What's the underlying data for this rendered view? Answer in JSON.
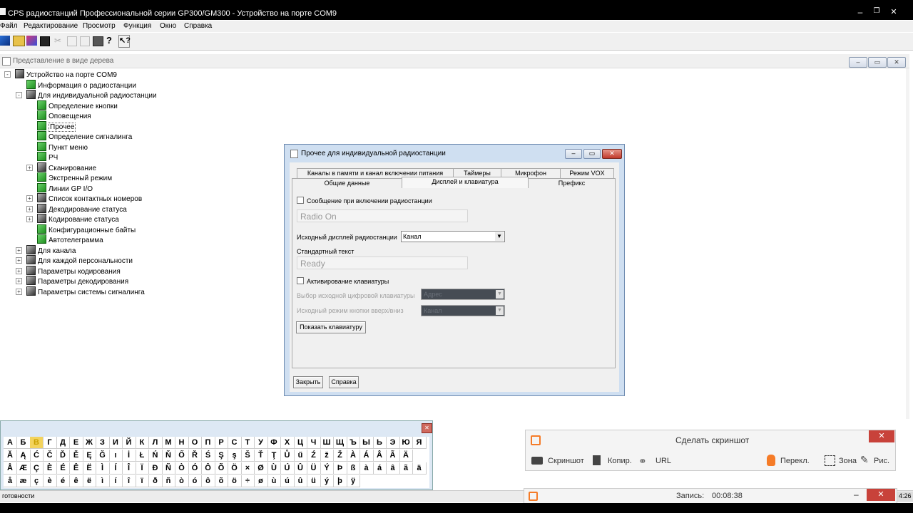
{
  "app": {
    "title": "CPS радиостанций Профессиональной серии GP300/GM300 - Устройство на порте COM9",
    "menu": [
      "Файл",
      "Редактирование",
      "Просмотр",
      "Функция",
      "Окно",
      "Справка"
    ],
    "status": "готовности",
    "clock": "4:26"
  },
  "tree_window": {
    "title": "Представление в виде дерева",
    "items": [
      {
        "label": "Устройство на порте COM9",
        "level": 0,
        "icon": "dark",
        "expander": "-"
      },
      {
        "label": "Информация о радиостанции",
        "level": 1,
        "icon": "green",
        "expander": ""
      },
      {
        "label": "Для индивидуальной радиостанции",
        "level": 1,
        "icon": "dark",
        "expander": "-"
      },
      {
        "label": "Определение кнопки",
        "level": 2,
        "icon": "green",
        "expander": ""
      },
      {
        "label": "Оповещения",
        "level": 2,
        "icon": "green",
        "expander": ""
      },
      {
        "label": "Прочее",
        "level": 2,
        "icon": "green",
        "expander": "",
        "selected": true
      },
      {
        "label": "Определение сигналинга",
        "level": 2,
        "icon": "green",
        "expander": ""
      },
      {
        "label": "Пункт меню",
        "level": 2,
        "icon": "green",
        "expander": ""
      },
      {
        "label": "РЧ",
        "level": 2,
        "icon": "green",
        "expander": ""
      },
      {
        "label": "Сканирование",
        "level": 2,
        "icon": "dark",
        "expander": "+"
      },
      {
        "label": "Экстренный режим",
        "level": 2,
        "icon": "green",
        "expander": ""
      },
      {
        "label": "Линии GP I/O",
        "level": 2,
        "icon": "green",
        "expander": ""
      },
      {
        "label": "Список контактных номеров",
        "level": 2,
        "icon": "dark",
        "expander": "+"
      },
      {
        "label": "Декодирование статуса",
        "level": 2,
        "icon": "dark",
        "expander": "+"
      },
      {
        "label": "Кодирование статуса",
        "level": 2,
        "icon": "dark",
        "expander": "+"
      },
      {
        "label": "Конфигурационные байты",
        "level": 2,
        "icon": "green",
        "expander": ""
      },
      {
        "label": "Автотелеграмма",
        "level": 2,
        "icon": "green",
        "expander": ""
      },
      {
        "label": "Для канала",
        "level": 1,
        "icon": "dark",
        "expander": "+"
      },
      {
        "label": "Для каждой персональности",
        "level": 1,
        "icon": "dark",
        "expander": "+"
      },
      {
        "label": "Параметры кодирования",
        "level": 1,
        "icon": "dark",
        "expander": "+"
      },
      {
        "label": "Параметры  декодирования",
        "level": 1,
        "icon": "dark",
        "expander": "+"
      },
      {
        "label": "Параметры системы сигналинга",
        "level": 1,
        "icon": "dark",
        "expander": "+"
      }
    ]
  },
  "dialog": {
    "title": "Прочее для индивидуальной радиостанции",
    "tabs_row1": [
      "Каналы в памяти и канал включении питания",
      "Таймеры",
      "Микрофон",
      "Режим VOX"
    ],
    "tabs_row2": [
      "Общие данные",
      "Дисплей и клавиатура",
      "Префикс"
    ],
    "power_on_msg_label": "Сообщение при включении радиостанции",
    "power_on_msg_value": "Radio On",
    "default_display_label": "Исходный дисплей радиостанции",
    "default_display_value": "Канал",
    "standard_text_label": "Стандартный текст",
    "standard_text_value": "Ready",
    "keypad_enable_label": "Активирование клавиатуры",
    "keypad_default_label": "Выбор исходной цифровой клавиатуры",
    "keypad_default_value": "Адрес",
    "updown_default_label": "Исходный режим кнопки вверх/вниз",
    "updown_default_value": "Канал",
    "show_keypad_button": "Показать клавиатуру",
    "close_button": "Закрыть",
    "help_button": "Справка"
  },
  "keyboard": {
    "rows": [
      [
        "А",
        "Б",
        "В",
        "Г",
        "Д",
        "Е",
        "Ж",
        "З",
        "И",
        "Й",
        "К",
        "Л",
        "М",
        "Н",
        "О",
        "П",
        "Р",
        "С",
        "Т",
        "У",
        "Ф",
        "Х",
        "Ц",
        "Ч",
        "Ш",
        "Щ",
        "Ъ",
        "Ы",
        "Ь",
        "Э",
        "Ю",
        "Я"
      ],
      [
        "Ă",
        "Ą",
        "Ć",
        "Č",
        "Ď",
        "Ě",
        "Ę",
        "Ğ",
        "ı",
        "İ",
        "Ł",
        "Ń",
        "Ň",
        "Ő",
        "Ř",
        "Ś",
        "Ş",
        "ş",
        "Š",
        "Ť",
        "Ţ",
        "Ů",
        "ű",
        "Ź",
        "ž",
        "Ž",
        "À",
        "Á",
        "Â",
        "Ã",
        "Ä"
      ],
      [
        "Å",
        "Æ",
        "Ç",
        "È",
        "É",
        "Ê",
        "Ë",
        "Ì",
        "Í",
        "Î",
        "Ï",
        "Ð",
        "Ñ",
        "Ò",
        "Ó",
        "Ô",
        "Õ",
        "Ö",
        "×",
        "Ø",
        "Ù",
        "Ú",
        "Û",
        "Ü",
        "Ý",
        "Þ",
        "ß",
        "à",
        "á",
        "â",
        "ã",
        "ä"
      ],
      [
        "å",
        "æ",
        "ç",
        "è",
        "é",
        "ê",
        "ë",
        "ì",
        "í",
        "î",
        "ï",
        "ð",
        "ñ",
        "ò",
        "ó",
        "ô",
        "õ",
        "ö",
        "÷",
        "ø",
        "ù",
        "ú",
        "û",
        "ü",
        "ý",
        "þ",
        "ÿ"
      ]
    ]
  },
  "screenshot_tool": {
    "title": "Сделать скриншот",
    "buttons": [
      "Скриншот",
      "Копир.",
      "URL",
      "Перекл.",
      "Зона",
      "Рис."
    ],
    "record_label": "Запись:",
    "record_time": "00:08:38"
  },
  "colors": {
    "titlebar_bg": "#000000",
    "selection": "#3399ff",
    "accent_orange": "#f57b27",
    "close_red": "#c8423a"
  }
}
